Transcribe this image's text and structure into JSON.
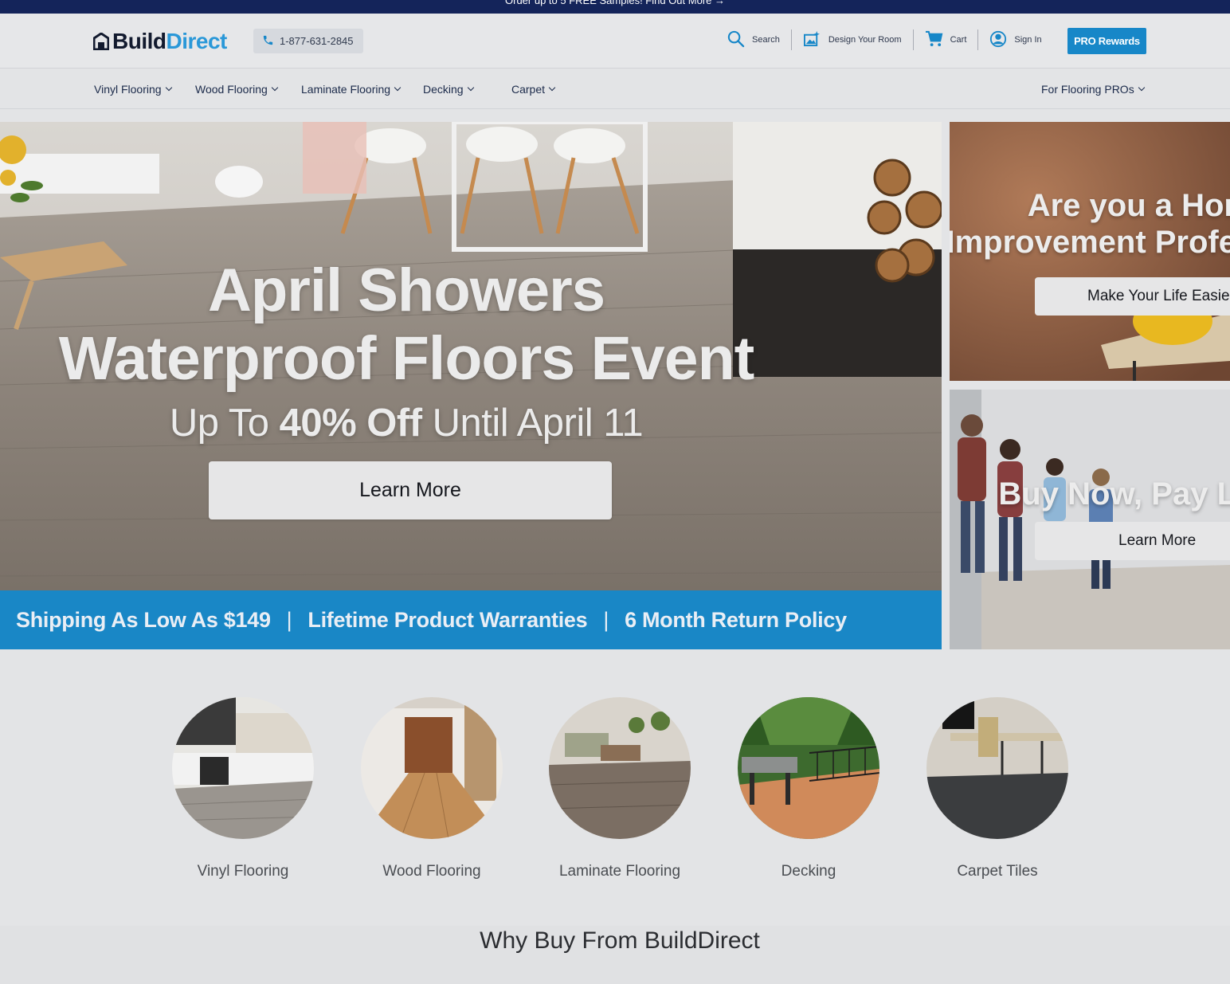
{
  "promo": {
    "text": "Order up to 5 FREE Samples!   Find Out More →"
  },
  "header": {
    "logo_part1": "Build",
    "logo_part2": "Direct",
    "phone": "1-877-631-2845",
    "search_label": "Search",
    "design_label": "Design Your Room",
    "cart_label": "Cart",
    "signin_label": "Sign In",
    "pro_rewards_label": "PRO Rewards"
  },
  "nav": {
    "items": [
      "Vinyl Flooring",
      "Wood Flooring",
      "Laminate Flooring",
      "Decking",
      "Carpet"
    ],
    "right_item": "For Flooring PROs"
  },
  "hero": {
    "line1": "April Showers",
    "line2": "Waterproof Floors Event",
    "line3_prefix": "Up To ",
    "line3_bold": "40% Off",
    "line3_suffix": " Until April 11",
    "button": "Learn More"
  },
  "value_bar": {
    "items": [
      "Shipping As Low As $149",
      "Lifetime Product Warranties",
      "6 Month Return Policy"
    ],
    "separator": "|"
  },
  "side_promos": [
    {
      "title_line1": "Are you a Hor",
      "title_line2": "Improvement Profe",
      "button": "Make Your Life Easier"
    },
    {
      "title_line1": "Buy Now, Pay L",
      "button": "Learn More"
    }
  ],
  "categories": [
    "Vinyl Flooring",
    "Wood Flooring",
    "Laminate Flooring",
    "Decking",
    "Carpet Tiles"
  ],
  "why": {
    "title": "Why Buy From BuildDirect"
  },
  "colors": {
    "navy": "#14245a",
    "brand_blue": "#1787c8",
    "logo_blue": "#2a98d8"
  }
}
